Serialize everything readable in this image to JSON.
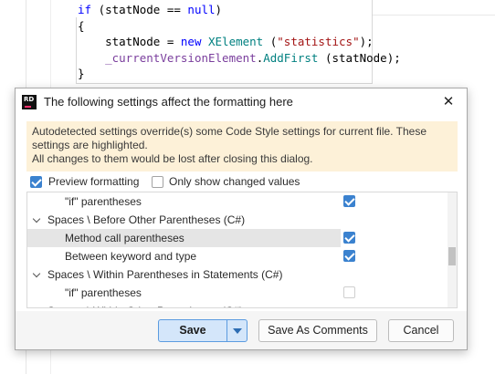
{
  "editor": {
    "lines": [
      {
        "parts": [
          {
            "t": "if",
            "c": "kw"
          },
          {
            "t": " (statNode == ",
            "c": ""
          },
          {
            "t": "null",
            "c": "kw"
          },
          {
            "t": ")",
            "c": ""
          }
        ]
      },
      {
        "parts": [
          {
            "t": "{",
            "c": ""
          }
        ]
      },
      {
        "parts": [
          {
            "t": "    statNode = ",
            "c": ""
          },
          {
            "t": "new",
            "c": "kw"
          },
          {
            "t": " ",
            "c": ""
          },
          {
            "t": "XElement",
            "c": "mth"
          },
          {
            "t": " (",
            "c": ""
          },
          {
            "t": "\"statistics\"",
            "c": "str"
          },
          {
            "t": ");",
            "c": ""
          }
        ]
      },
      {
        "parts": [
          {
            "t": "    ",
            "c": ""
          },
          {
            "t": "_currentVersionElement",
            "c": "fld"
          },
          {
            "t": ".",
            "c": ""
          },
          {
            "t": "AddFirst",
            "c": "mth"
          },
          {
            "t": " (statNode);",
            "c": ""
          }
        ]
      },
      {
        "parts": [
          {
            "t": "}",
            "c": ""
          }
        ]
      }
    ]
  },
  "dialog": {
    "logo_text": "RD",
    "title": "The following settings affect the formatting here",
    "close_label": "✕",
    "warning": {
      "line1": "Autodetected settings override(s) some Code Style settings for current file. These",
      "line2": "settings are highlighted.",
      "line3": "All changes to them would be lost after closing this dialog."
    },
    "options": {
      "preview_label": "Preview formatting",
      "preview_checked": true,
      "only_changed_label": "Only show changed values",
      "only_changed_checked": false
    },
    "tree_rows": [
      {
        "label": "\"if\" parentheses",
        "type": "item",
        "checked": true,
        "selected": false
      },
      {
        "label": "Spaces \\ Before Other Parentheses (C#)",
        "type": "group"
      },
      {
        "label": "Method call parentheses",
        "type": "item",
        "checked": true,
        "selected": true
      },
      {
        "label": "Between keyword and type",
        "type": "item",
        "checked": true,
        "selected": false
      },
      {
        "label": "Spaces \\ Within Parentheses in Statements (C#)",
        "type": "group"
      },
      {
        "label": "\"if\" parentheses",
        "type": "item",
        "checked": false,
        "selected": false
      },
      {
        "label": "Spaces \\ Within Other Parentheses (C#)",
        "type": "group"
      }
    ],
    "buttons": {
      "save": "Save",
      "save_as_comments": "Save As Comments",
      "cancel": "Cancel"
    }
  },
  "colors": {
    "accent": "#3b82cf",
    "warning_bg": "#fdf1d8",
    "selection_bg": "#e5e5e5",
    "save_bg": "#d4e6fa"
  }
}
